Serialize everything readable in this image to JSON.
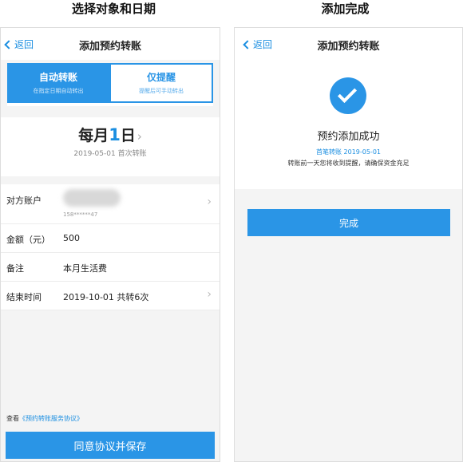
{
  "captions": {
    "left": "选择对象和日期",
    "right": "添加完成"
  },
  "left_screen": {
    "nav": {
      "back_label": "返回",
      "title": "添加预约转账"
    },
    "mode": {
      "auto": {
        "title": "自动转账",
        "subtitle": "在指定日期自动转出"
      },
      "remind": {
        "title": "仅提醒",
        "subtitle": "提醒后可手动转出"
      }
    },
    "date": {
      "prefix": "每月",
      "day": "1",
      "suffix": "日",
      "sub": "2019-05-01 首次转账"
    },
    "form": {
      "account": {
        "label": "对方账户",
        "number": "158******47"
      },
      "amount": {
        "label": "金额（元）",
        "value": "500"
      },
      "note": {
        "label": "备注",
        "value": "本月生活费"
      },
      "end": {
        "label": "结束时间",
        "value": "2019-10-01 共转6次"
      }
    },
    "agreement": {
      "prefix": "查看",
      "link": "《预约转账服务协议》"
    },
    "save_button": "同意协议并保存"
  },
  "right_screen": {
    "nav": {
      "back_label": "返回",
      "title": "添加预约转账"
    },
    "success": {
      "title": "预约添加成功",
      "first_transfer": "首笔转账 2019-05-01",
      "note": "转账前一天您将收到提醒，请确保资金充足"
    },
    "done_button": "完成"
  },
  "colors": {
    "accent": "#2a95e6",
    "link": "#1a8ee1"
  }
}
